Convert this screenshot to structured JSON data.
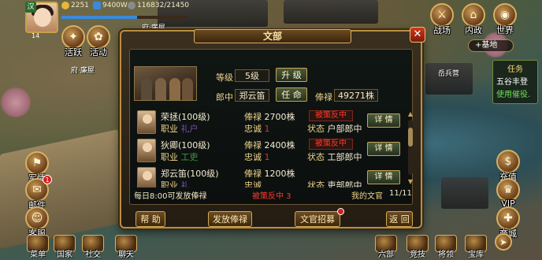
{
  "player": {
    "nation_tag": "汉",
    "level": "14",
    "gold": "2251",
    "food": "9400W",
    "food_capacity": "116832/21450"
  },
  "top_right": {
    "battle": "战场",
    "domestic": "内政",
    "world": "世界",
    "base": "+基地",
    "task_title": "任务",
    "task_line1": "五谷丰登",
    "task_line2": "使用催役."
  },
  "left_buttons": {
    "activity": "活跃",
    "event": "活动",
    "military": "军情",
    "mail": "邮件",
    "mail_badge": "1",
    "service": "客服"
  },
  "right_buttons": {
    "recharge": "充值",
    "vip": "VIP",
    "mall": "商城"
  },
  "bottom_bar": {
    "menu": "菜单",
    "nation": "国家",
    "social": "社交",
    "chat": "聊天",
    "six_ministries": "六部",
    "compete": "竞技",
    "general": "将领",
    "treasury": "宝库"
  },
  "map_labels": {
    "house1": "府·廉屋",
    "house2": "府·廉屋",
    "barracks": "兵营",
    "label_yuanbing": "岳兵营"
  },
  "dialog": {
    "title": "文部",
    "close": "✕",
    "level_label": "等级",
    "level_value": "5级",
    "upgrade_btn": "升 级",
    "minister_label": "郎中",
    "minister_value": "郑云笛",
    "appoint_btn": "任 命",
    "salary_label": "俸禄",
    "salary_value": "49271株",
    "officials": [
      {
        "name": "荣拯(100级)",
        "job_label": "职业",
        "job_value": "礼户",
        "salary_label": "俸禄",
        "salary_value": "2700株",
        "loyalty_label": "忠诚",
        "loyalty_value": "1",
        "tag": "被策反中",
        "status_label": "状态",
        "status_value": "户部郎中",
        "detail": "详 情"
      },
      {
        "name": "狄卿(100级)",
        "job_label": "职业",
        "job_value": "工吏",
        "salary_label": "俸禄",
        "salary_value": "2400株",
        "loyalty_label": "忠诚",
        "loyalty_value": "1",
        "tag": "被策反中",
        "status_label": "状态",
        "status_value": "工部郎中",
        "detail": "详 情"
      },
      {
        "name": "郑云笛(100级)",
        "job_label": "职业",
        "job_value": "礼",
        "salary_label": "俸禄",
        "salary_value": "1200株",
        "loyalty_label": "忠诚",
        "loyalty_value": "",
        "tag": "",
        "status_label": "状态",
        "status_value": "吏部郎中",
        "detail": "详 情"
      }
    ],
    "footer_left": "每日8:00可发放俸禄",
    "footer_mid": "被策反中 3",
    "footer_right_label": "我的文官",
    "footer_right_value": "11/11",
    "btn_help": "帮 助",
    "btn_salary": "发放俸禄",
    "btn_recruit": "文官招募",
    "btn_back": "返 回"
  }
}
